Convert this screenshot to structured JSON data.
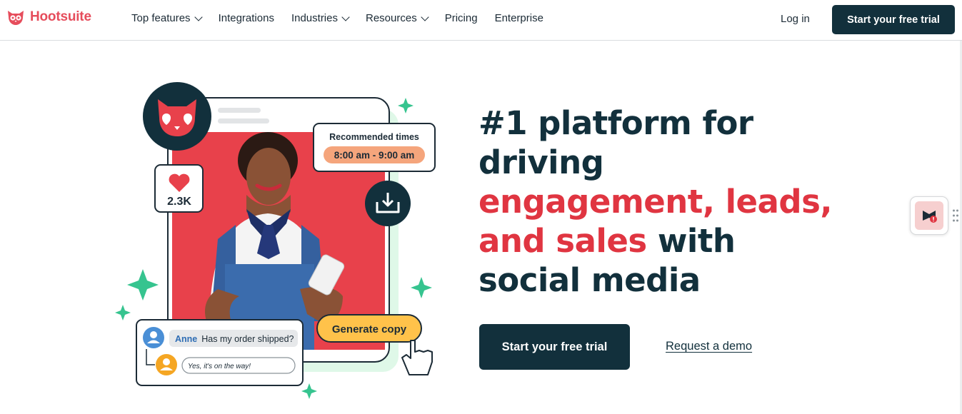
{
  "brand": {
    "name": "Hootsuite",
    "accent": "#e64d5c"
  },
  "nav": {
    "items": [
      {
        "label": "Top features",
        "has_dropdown": true
      },
      {
        "label": "Integrations",
        "has_dropdown": false
      },
      {
        "label": "Industries",
        "has_dropdown": true
      },
      {
        "label": "Resources",
        "has_dropdown": true
      },
      {
        "label": "Pricing",
        "has_dropdown": false
      },
      {
        "label": "Enterprise",
        "has_dropdown": false
      }
    ],
    "login": "Log in",
    "cta": "Start your free trial"
  },
  "hero": {
    "headline_line1": "#1 platform for",
    "headline_line2": "driving",
    "headline_red1": "engagement, leads,",
    "headline_red2": "and sales",
    "headline_tail": " with",
    "headline_line5": "social media",
    "cta_primary": "Start your free trial",
    "cta_secondary": "Request a demo",
    "colors": {
      "navy": "#12303c",
      "red": "#e03541"
    }
  },
  "illustration": {
    "recommended_title": "Recommended times",
    "recommended_time": "8:00 am - 9:00 am",
    "likes": "2.3K",
    "generate_copy": "Generate copy",
    "chat_name": "Anne",
    "chat_question": "Has my order shipped?",
    "chat_reply": "Yes, it's on the way!"
  }
}
